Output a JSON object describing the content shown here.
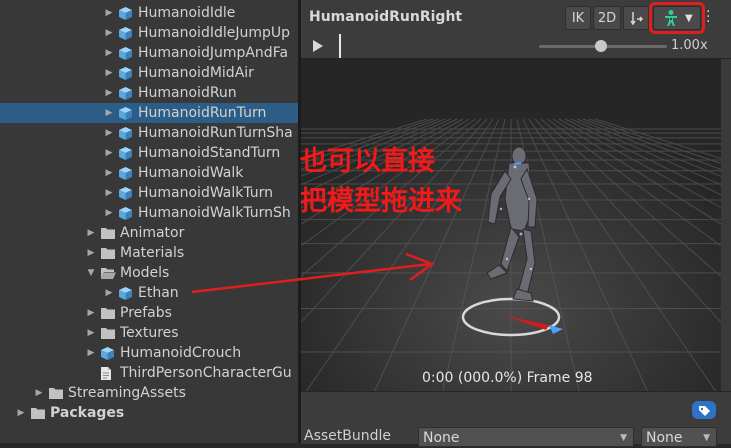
{
  "project_tree": {
    "rows": [
      {
        "label": "HumanoidIdle",
        "icon": "model-cube-icon",
        "arrow": "▶",
        "indent": 1,
        "selected": false
      },
      {
        "label": "HumanoidIdleJumpUp",
        "icon": "model-cube-icon",
        "arrow": "▶",
        "indent": 1,
        "selected": false
      },
      {
        "label": "HumanoidJumpAndFa",
        "icon": "model-cube-icon",
        "arrow": "▶",
        "indent": 1,
        "selected": false
      },
      {
        "label": "HumanoidMidAir",
        "icon": "model-cube-icon",
        "arrow": "▶",
        "indent": 1,
        "selected": false
      },
      {
        "label": "HumanoidRun",
        "icon": "model-cube-icon",
        "arrow": "▶",
        "indent": 1,
        "selected": false
      },
      {
        "label": "HumanoidRunTurn",
        "icon": "model-cube-icon",
        "arrow": "▶",
        "indent": 1,
        "selected": true
      },
      {
        "label": "HumanoidRunTurnSha",
        "icon": "model-cube-icon",
        "arrow": "▶",
        "indent": 1,
        "selected": false
      },
      {
        "label": "HumanoidStandTurn",
        "icon": "model-cube-icon",
        "arrow": "▶",
        "indent": 1,
        "selected": false
      },
      {
        "label": "HumanoidWalk",
        "icon": "model-cube-icon",
        "arrow": "▶",
        "indent": 1,
        "selected": false
      },
      {
        "label": "HumanoidWalkTurn",
        "icon": "model-cube-icon",
        "arrow": "▶",
        "indent": 1,
        "selected": false
      },
      {
        "label": "HumanoidWalkTurnSh",
        "icon": "model-cube-icon",
        "arrow": "▶",
        "indent": 1,
        "selected": false
      },
      {
        "label": "Animator",
        "icon": "folder-icon",
        "arrow": "▶",
        "indent": 0,
        "selected": false
      },
      {
        "label": "Materials",
        "icon": "folder-icon",
        "arrow": "▶",
        "indent": 0,
        "selected": false
      },
      {
        "label": "Models",
        "icon": "folder-open-icon",
        "arrow": "▼",
        "indent": 0,
        "selected": false
      },
      {
        "label": "Ethan",
        "icon": "model-cube-icon",
        "arrow": "▶",
        "indent": 1,
        "selected": false
      },
      {
        "label": "Prefabs",
        "icon": "folder-icon",
        "arrow": "▶",
        "indent": 0,
        "selected": false
      },
      {
        "label": "Textures",
        "icon": "folder-icon",
        "arrow": "▶",
        "indent": 0,
        "selected": false
      },
      {
        "label": "HumanoidCrouch",
        "icon": "model-cube-icon",
        "arrow": "▶",
        "indent": 0,
        "selected": false
      },
      {
        "label": "ThirdPersonCharacterGu",
        "icon": "script-doc-icon",
        "arrow": "",
        "indent": 0,
        "selected": false
      },
      {
        "label": "StreamingAssets",
        "icon": "folder-icon",
        "arrow": "▶",
        "indent": -1,
        "selected": false
      },
      {
        "label": "Packages",
        "icon": "folder-icon",
        "arrow": "▶",
        "indent": -2,
        "selected": false,
        "bold": true
      }
    ]
  },
  "preview": {
    "clip_name": "HumanoidRunRight",
    "toolbar": {
      "ik_label": "IK",
      "two_d_label": "2D",
      "pivot_icon": "pivot-icon",
      "avatar_icon": "avatar-figure-icon",
      "dropdown_icon": "chevron-down-icon",
      "more_icon": "kebab-menu-icon"
    },
    "playback": {
      "play_icon": "play-icon",
      "speed_label": "1.00x",
      "speed_value": 1.0
    },
    "frame_info": "0:00 (000.0%) Frame 98"
  },
  "inspector_footer": {
    "tag_icon": "tag-icon",
    "asset_bundle_label": "AssetBundle",
    "asset_bundle_value": "None",
    "variant_value": "None"
  },
  "annotation": {
    "line1": "也可以直接",
    "line2": "把模型拖进来",
    "color": "#f01a1a"
  },
  "colors": {
    "selection": "#2c5d87",
    "highlight_box": "#e01e1e",
    "avatar_green": "#2fcf9a",
    "cube_blue": "#6cb8e8"
  }
}
